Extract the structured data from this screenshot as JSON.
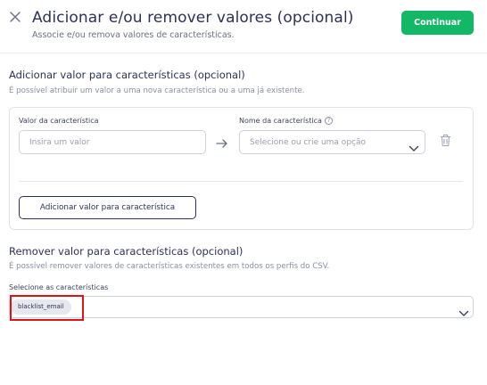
{
  "header": {
    "title": "Adicionar e/ou remover valores (opcional)",
    "subtitle": "Associe e/ou remova valores de características.",
    "continue_label": "Continuar"
  },
  "add_section": {
    "title": "Adicionar valor para características (opcional)",
    "description": "É possível atribuir um valor a uma nova característica ou a uma já existente.",
    "value_label": "Valor da característica",
    "value_placeholder": "Insira um valor",
    "name_label": "Nome da característica",
    "name_placeholder": "Selecione ou crie uma opção",
    "add_button_label": "Adicionar valor para característica"
  },
  "remove_section": {
    "title": "Remover valor para características (opcional)",
    "description": "É possível remover valores de características existentes em todos os perfis do CSV.",
    "select_label": "Selecione as características",
    "selected_chips": [
      "blacklist_email"
    ]
  },
  "icons": {
    "close": "close-icon",
    "info": "info-icon",
    "arrow": "arrow-right-icon",
    "trash": "trash-icon",
    "chevron": "chevron-down-icon"
  },
  "colors": {
    "primary": "#12b866",
    "text_dark": "#2d3158",
    "highlight": "#e01414"
  }
}
